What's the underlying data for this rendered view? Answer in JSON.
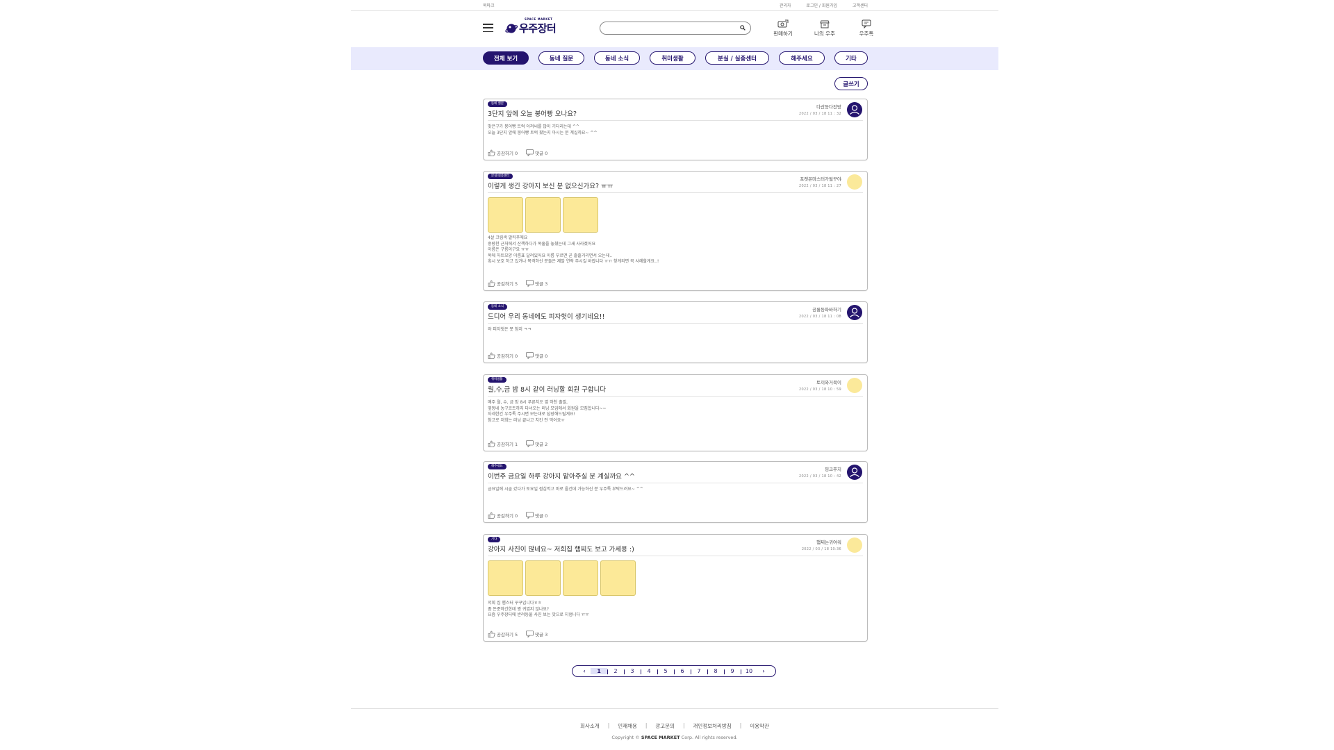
{
  "topbar": {
    "bookmark": "북마크",
    "links": [
      "관리자",
      "로그인 / 회원가입",
      "고객센터"
    ]
  },
  "header": {
    "logo_small": "SPACE MARKET",
    "logo_title": "우주장터",
    "search_placeholder": "",
    "nav": [
      {
        "label": "판매하기",
        "icon": "sell-icon"
      },
      {
        "label": "나의 우주",
        "icon": "my-space-icon"
      },
      {
        "label": "우주톡",
        "icon": "chat-icon"
      }
    ]
  },
  "categories": [
    {
      "label": "전체 보기",
      "active": true
    },
    {
      "label": "동네 질문",
      "active": false
    },
    {
      "label": "동네 소식",
      "active": false
    },
    {
      "label": "취미생활",
      "active": false
    },
    {
      "label": "분실 / 실종센터",
      "active": false
    },
    {
      "label": "해주세요",
      "active": false
    },
    {
      "label": "기타",
      "active": false
    }
  ],
  "write_label": "글쓰기",
  "posts": [
    {
      "tag": "동네 질문",
      "title": "3단지 앞에 오늘 붕어빵 오나요?",
      "author": "다산동다잔망",
      "date": "2022 / 03 / 18    11 : 32",
      "avatar": "person",
      "body": "맞은구가 붕어빵 트럭 아저씨를 많이 기다리는데 ^^\n오늘 3단지 앞에 붕어빵 트럭 왔는지 아시는 분 계실까요~ ^^",
      "images": 0,
      "likes": "공감하기 0",
      "comments": "댓글 0"
    },
    {
      "tag": "분실/실종센터",
      "title": "이렇게 생긴 강아지 보신 분 없으신가요? ㅠㅠ",
      "author": "포켓몬마스터가될꾸야",
      "date": "2022 / 03 / 18    11 : 27",
      "avatar": "yellow",
      "body": "4살 크림색 말티푸에요\n중랑천 근처에서 산책하다가 목줄을 놓쳤는데 그새 사라졌어요\n이름은 구름이구요 ㅠㅠ\n목에 하트모양 이름표 달려있어요 이름 부르면 곧 졸졸거리면서 오는데..\n혹시 보호 하고 있거나 목격하신 분들은 제발 연락 주시길 바랍니다 ㅠㅠ 찾게되면 꼭 사례할게요..!",
      "images": 3,
      "likes": "공감하기 5",
      "comments": "댓글 3"
    },
    {
      "tag": "동네 소식",
      "title": "드디어 우리 동네에도 피자헛이 생기네요!!",
      "author": "공룡동파바하기",
      "date": "2022 / 03 / 18    11 : 08",
      "avatar": "person",
      "body": "와 피자헛은 못 참지 ㅋㅋ",
      "images": 0,
      "likes": "공감하기 0",
      "comments": "댓글 0"
    },
    {
      "tag": "취미생활",
      "title": "월,수,금 밤 8시 같이 러닝할 회원 구합니다",
      "author": "토끼와거북이",
      "date": "2022 / 03 / 18    10 : 59",
      "avatar": "yellow",
      "body": "매주 월, 수, 금 밤 8시 푸른치오 옆 하천 출발,\n옆동네 농구코트까지 다녀오는 러닝 모임에서 회원을 모집합니다~~\n자세한건 우주톡 주시면 보는대로 답장해드릴게요!\n참고로 저희는 러닝 끝나고 치킨 안 먹어요ㅠ",
      "images": 0,
      "likes": "공감하기 1",
      "comments": "댓글 2"
    },
    {
      "tag": "해주세요",
      "title": "이번주 금요일 하루 강아지 맡아주실 분 계실까요 ^^",
      "author": "핑크푸치",
      "date": "2022 / 03 / 18    10 : 42",
      "avatar": "person",
      "body": "금요일에 시골 갔다가 토요일 점심먹고 바로 올건데 가능하신 분 우주톡 부탁드려요~ ^^",
      "images": 0,
      "likes": "공감하기 0",
      "comments": "댓글 0"
    },
    {
      "tag": "기타",
      "title": "강아지 사진이 많네요~ 저희집 햄찌도 보고 가세용 :)",
      "author": "햄찌는귀여워",
      "date": "2022 / 03 / 18    10:36",
      "avatar": "yellow",
      "body": "저희 집 햄스터 꾸꾸입니다ㅎㅎ\n좀 돈준하긴한데 짱 귀엽지 않나요?\n요즘 우주장터에 반려동물 사진 보는 맛으로 지냅니다 ㅠㅠ",
      "images": 4,
      "likes": "공감하기 5",
      "comments": "댓글 3"
    }
  ],
  "pagination": {
    "prev": "‹",
    "next": "›",
    "pages": [
      "1",
      "2",
      "3",
      "4",
      "5",
      "6",
      "7",
      "8",
      "9",
      "10"
    ],
    "current": "1"
  },
  "footer": {
    "links": [
      "회사소개",
      "인재채용",
      "광고문의",
      "개인정보처리방침",
      "이용약관"
    ],
    "copyright_prefix": "Copyright © ",
    "copyright_brand": "SPACE MARKET",
    "copyright_suffix": " Corp. All rights reserved."
  },
  "colors": {
    "accent": "#24146e",
    "band": "#e9eafd",
    "thumb": "#fce998",
    "avatar_yellow": "#fbe99a"
  }
}
